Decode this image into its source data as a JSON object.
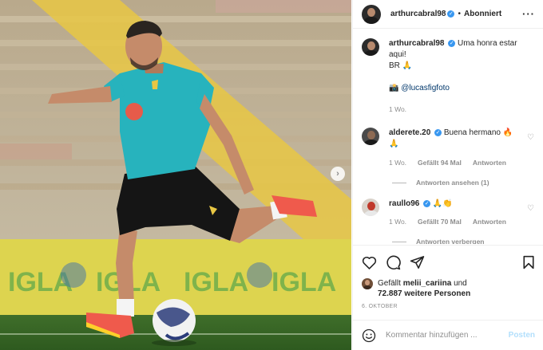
{
  "post": {
    "author": "arthurcabral98",
    "follow_status": "Abonniert",
    "more_icon": "more-options-icon",
    "caption_user": "arthurcabral98",
    "caption_text": "Uma honra estar aqui!",
    "caption_line2": "BR 🙏",
    "caption_line3_emoji": "📸",
    "caption_mention": "@lucasfigfoto",
    "caption_time": "1 Wo."
  },
  "comments": [
    {
      "user": "alderete.20",
      "text": "Buena hermano 🔥",
      "text2": "🙏",
      "time": "1 Wo.",
      "likes": "Gefällt 94 Mal",
      "reply": "Antworten",
      "thread": "Antworten ansehen (1)"
    },
    {
      "user": "raullo96",
      "text": "🙏👏",
      "time": "1 Wo.",
      "likes": "Gefällt 70 Mal",
      "reply": "Antworten",
      "thread": "Antworten verbergen"
    }
  ],
  "likes": {
    "prefix": "Gefällt",
    "user": "melii_cariina",
    "connector": "und",
    "count": "72.887 weitere Personen"
  },
  "date": "6. OKTOBER",
  "add_comment": {
    "placeholder": "Kommentar hinzufügen ...",
    "post_label": "Posten"
  },
  "icons": [
    "heart-icon",
    "comment-icon",
    "share-icon",
    "bookmark-icon",
    "emoji-icon",
    "next-arrow-icon"
  ]
}
